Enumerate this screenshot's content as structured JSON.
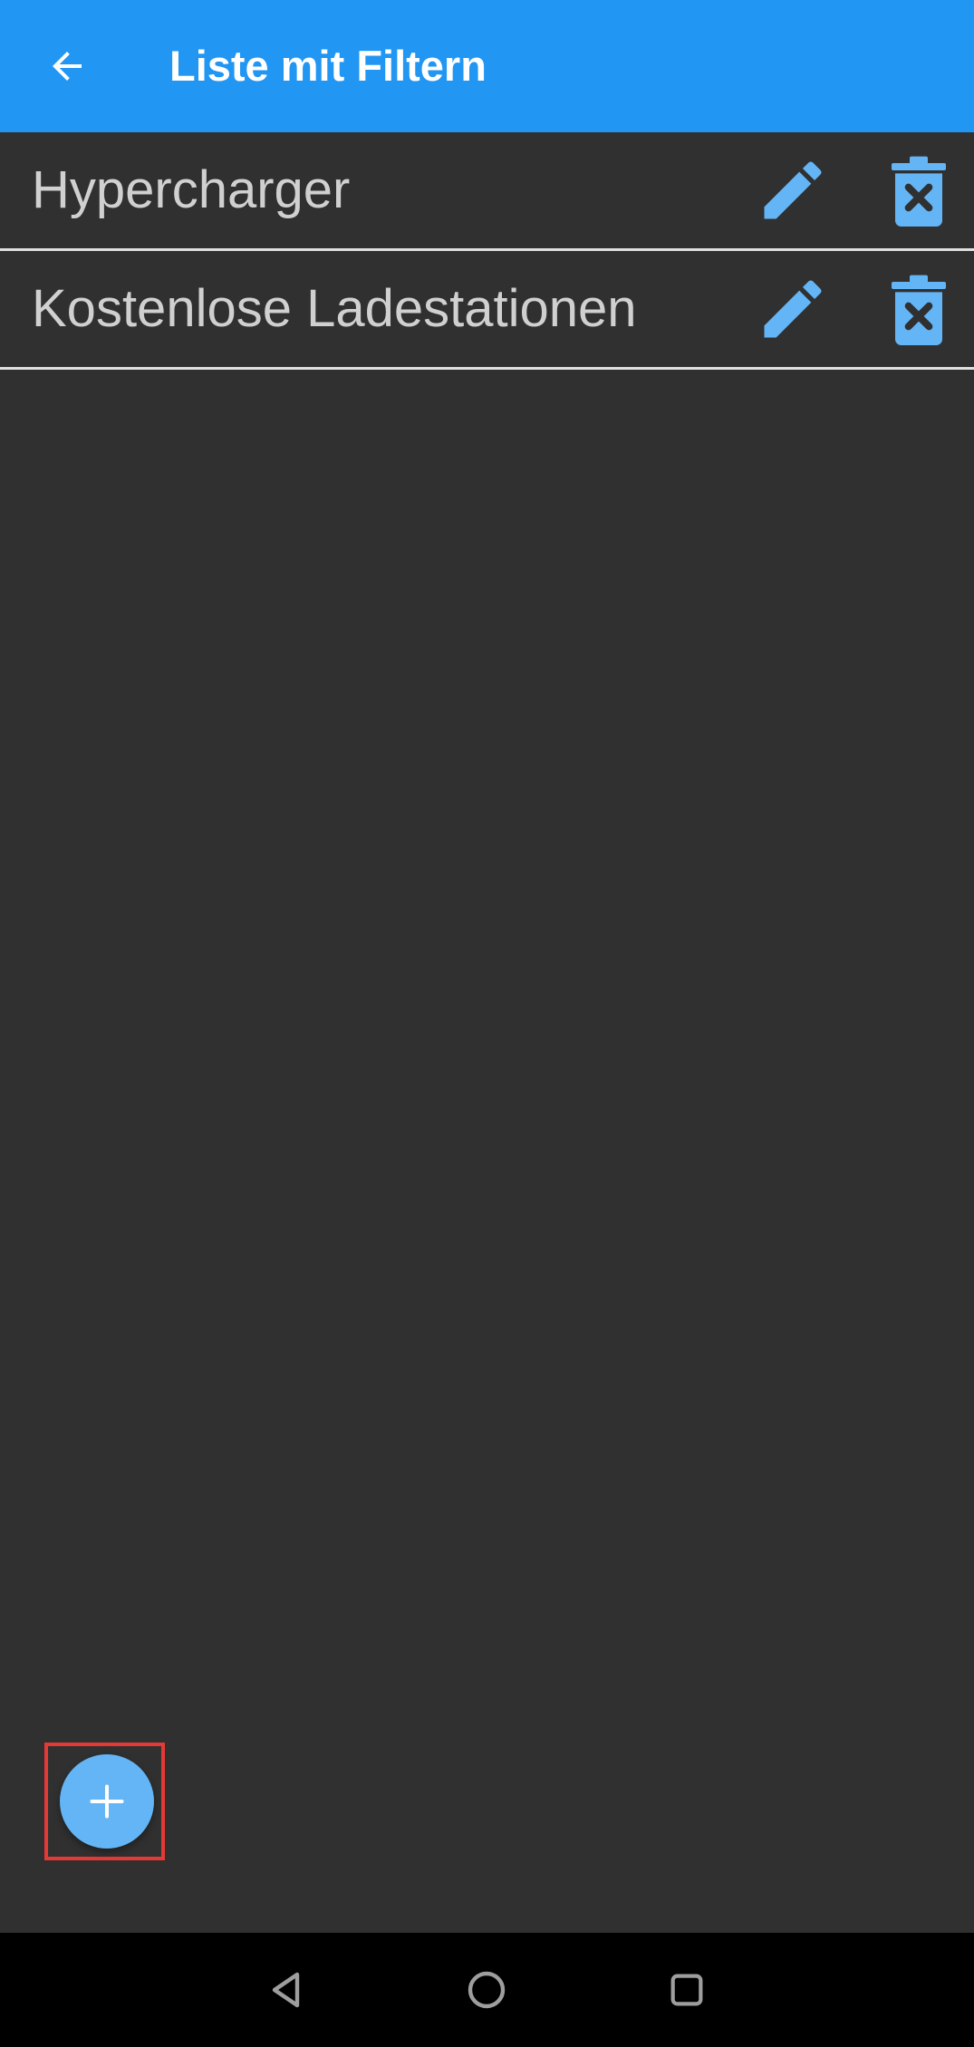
{
  "app_bar": {
    "title": "Liste mit Filtern",
    "back_icon": "arrow-back-icon",
    "background_color": "#2196F3"
  },
  "filters": [
    {
      "label": "Hypercharger",
      "edit_icon": "pencil-icon",
      "delete_icon": "trash-delete-icon"
    },
    {
      "label": "Kostenlose Ladestationen",
      "edit_icon": "pencil-icon",
      "delete_icon": "trash-delete-icon"
    }
  ],
  "fab": {
    "icon": "plus-icon",
    "color": "#64B5F6"
  },
  "system_nav": {
    "back_icon": "triangle-back-icon",
    "home_icon": "circle-home-icon",
    "recents_icon": "square-recents-icon"
  },
  "colors": {
    "background": "#303030",
    "accent_icon": "#64B5F6",
    "text": "#d0d0d0",
    "highlight": "#e53935"
  }
}
